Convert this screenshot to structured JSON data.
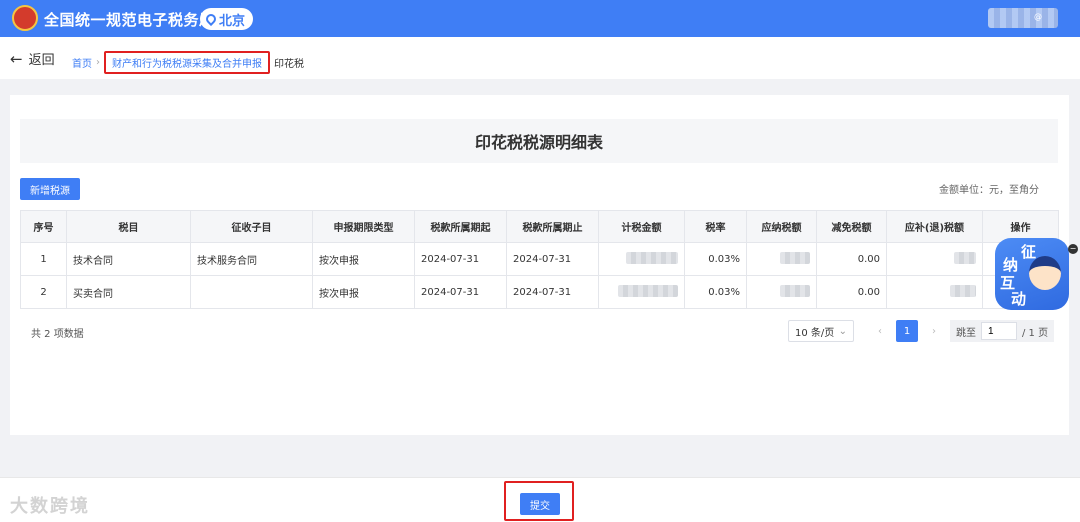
{
  "header": {
    "title": "全国统一规范电子税务局",
    "region": "北京",
    "user_initial": "@"
  },
  "nav": {
    "back_label": "返回",
    "breadcrumb": [
      "首页",
      "财产和行为税税源采集及合并申报",
      "印花税"
    ]
  },
  "main": {
    "title": "印花税税源明细表",
    "add_button": "新增税源",
    "unit_note": "金额单位：元，至角分",
    "columns": [
      "序号",
      "税目",
      "征收子目",
      "申报期限类型",
      "税款所属期起",
      "税款所属期止",
      "计税金额",
      "税率",
      "应纳税额",
      "减免税额",
      "应补(退)税额",
      "操作"
    ],
    "rows": [
      {
        "index": "1",
        "item": "技术合同",
        "sub_item": "技术服务合同",
        "period_type": "按次申报",
        "start": "2024-07-31",
        "end": "2024-07-31",
        "rate": "0.03%",
        "reduction": "0.00"
      },
      {
        "index": "2",
        "item": "买卖合同",
        "sub_item": "",
        "period_type": "按次申报",
        "start": "2024-07-31",
        "end": "2024-07-31",
        "rate": "0.03%",
        "reduction": "0.00"
      }
    ],
    "total_text": "共 2 项数据",
    "pagination": {
      "page_size": "10 条/页",
      "current_page": "1",
      "jump_label": "跳至",
      "jump_value": "1",
      "total_pages": "/ 1 页"
    }
  },
  "mascot": {
    "line1": "征",
    "line2": "纳",
    "line3": "互",
    "line4": "动"
  },
  "footer": {
    "submit": "提交",
    "watermark": "大数跨境"
  },
  "colors": {
    "primary": "#3f7ef5",
    "highlight": "#e02020"
  }
}
